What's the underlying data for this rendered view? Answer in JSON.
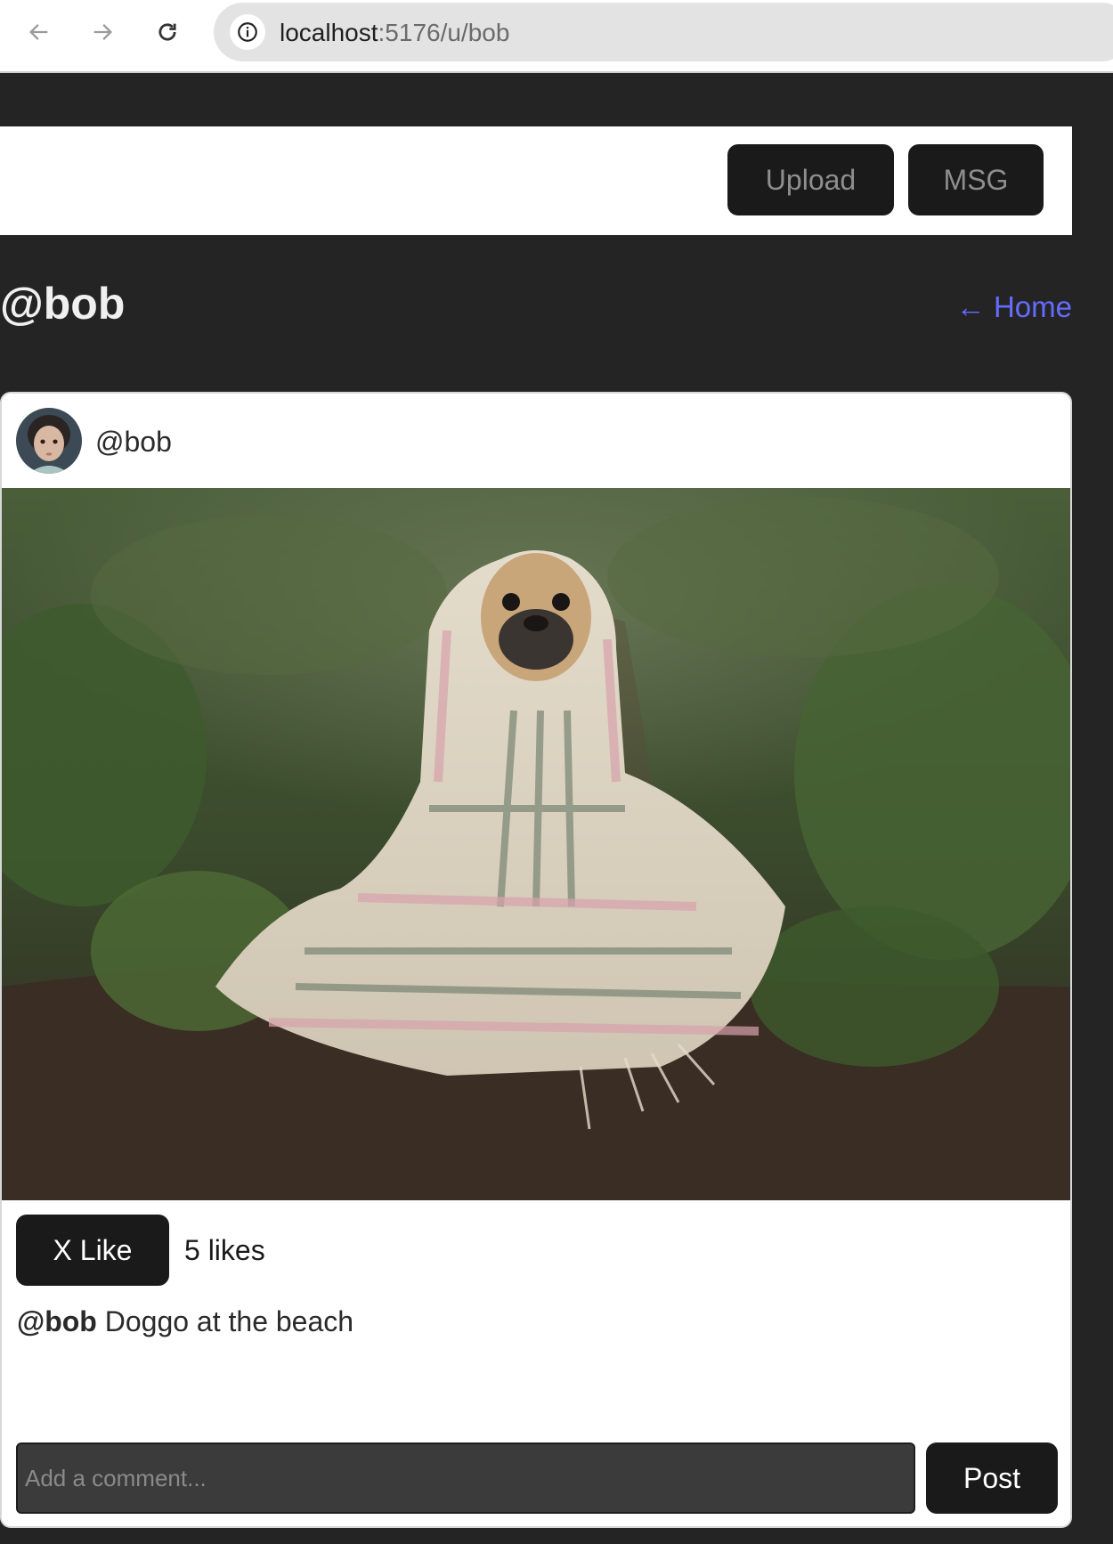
{
  "browser": {
    "url_host": "localhost",
    "url_path": ":5176/u/bob"
  },
  "topbar": {
    "upload_label": "Upload",
    "msg_label": "MSG"
  },
  "profile": {
    "title": "@bob",
    "home_link": "← Home"
  },
  "post": {
    "username": "@bob",
    "like_button_label": "X Like",
    "likes_text": "5 likes",
    "caption_user": "@bob",
    "caption_text": " Doggo at the beach",
    "comment_placeholder": "Add a comment...",
    "post_button_label": "Post"
  },
  "colors": {
    "page_bg": "#242424",
    "link": "#646cff",
    "button_dark": "#1a1a1a"
  },
  "icons": [
    "back-arrow-icon",
    "forward-arrow-icon",
    "reload-icon",
    "site-info-icon"
  ]
}
